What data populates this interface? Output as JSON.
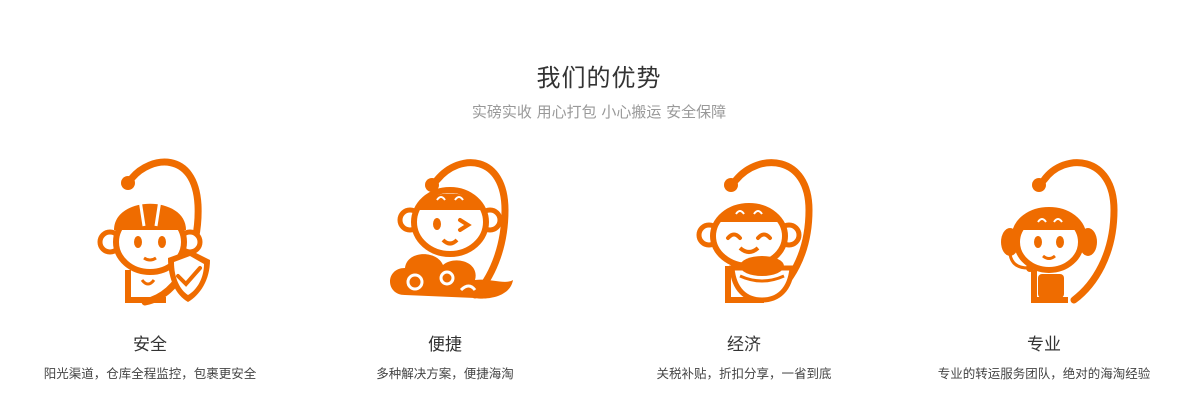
{
  "header": {
    "title": "我们的优势",
    "subtitle": "实磅实收 用心打包 小心搬运 安全保障"
  },
  "colors": {
    "accent": "#ef6c00",
    "title": "#333333",
    "subtitle": "#999999"
  },
  "features": [
    {
      "icon": "monkey-helmet-shield-icon",
      "name": "安全",
      "desc": "阳光渠道，仓库全程监控，包裹更安全"
    },
    {
      "icon": "monkey-cloud-wink-icon",
      "name": "便捷",
      "desc": "多种解决方案，便捷海淘"
    },
    {
      "icon": "monkey-gold-ingot-icon",
      "name": "经济",
      "desc": "关税补贴，折扣分享，一省到底"
    },
    {
      "icon": "monkey-headset-icon",
      "name": "专业",
      "desc": "专业的转运服务团队，绝对的海淘经验"
    }
  ]
}
